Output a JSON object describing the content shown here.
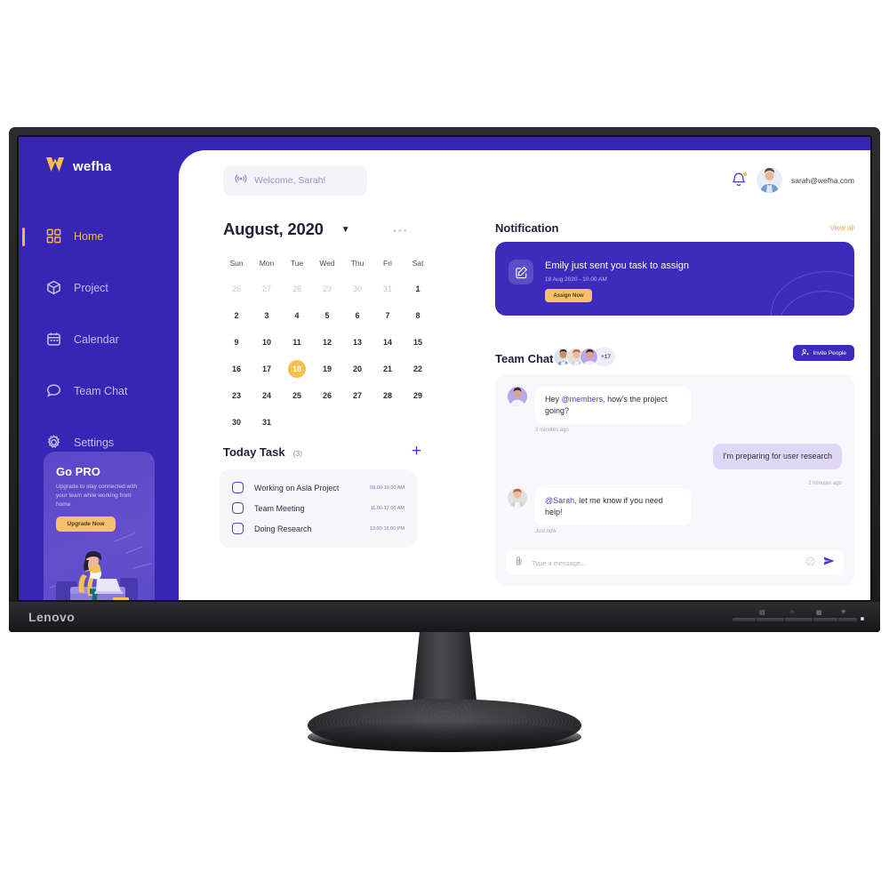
{
  "device": {
    "brand": "Lenovo",
    "control_labels": [
      "⏻",
      "☰",
      "≡",
      "↵"
    ]
  },
  "sidebar": {
    "brand": "wefha",
    "logo_icon": "wefha-w-logo-icon",
    "active_index": 0,
    "items": [
      {
        "label": "Home",
        "icon": "grid-icon"
      },
      {
        "label": "Project",
        "icon": "cube-icon"
      },
      {
        "label": "Calendar",
        "icon": "calendar-icon"
      },
      {
        "label": "Team Chat",
        "icon": "chat-bubble-icon"
      },
      {
        "label": "Settings",
        "icon": "gear-icon"
      }
    ],
    "promo": {
      "title": "Go PRO",
      "description": "Upgrade to stay connected with your team while working from home",
      "button": "Upgrade Now"
    }
  },
  "header": {
    "search_placeholder": "Welcome, Sarah!",
    "search_icon": "broadcast-icon",
    "bell_icon": "bell-icon",
    "avatar_icon": "user-avatar",
    "email": "sarah@wefha.com"
  },
  "calendar": {
    "title": "August, 2020",
    "caret_icon": "chevron-down-icon",
    "more_icon": "more-horizontal-icon",
    "day_names": [
      "Sun",
      "Mon",
      "Tue",
      "Wed",
      "Thu",
      "Fri",
      "Sat"
    ],
    "selected_day": 18,
    "weeks": [
      [
        {
          "d": "26",
          "mute": true
        },
        {
          "d": "27",
          "mute": true
        },
        {
          "d": "28",
          "mute": true
        },
        {
          "d": "29",
          "mute": true
        },
        {
          "d": "30",
          "mute": true
        },
        {
          "d": "31",
          "mute": true
        },
        {
          "d": "1",
          "mute": false
        }
      ],
      [
        {
          "d": "2",
          "mute": false
        },
        {
          "d": "3",
          "mute": false
        },
        {
          "d": "4",
          "mute": false
        },
        {
          "d": "5",
          "mute": false
        },
        {
          "d": "6",
          "mute": false
        },
        {
          "d": "7",
          "mute": false
        },
        {
          "d": "8",
          "mute": false
        }
      ],
      [
        {
          "d": "9",
          "mute": false
        },
        {
          "d": "10",
          "mute": false
        },
        {
          "d": "11",
          "mute": false
        },
        {
          "d": "12",
          "mute": false
        },
        {
          "d": "13",
          "mute": false
        },
        {
          "d": "14",
          "mute": false
        },
        {
          "d": "15",
          "mute": false
        }
      ],
      [
        {
          "d": "16",
          "mute": false
        },
        {
          "d": "17",
          "mute": false
        },
        {
          "d": "18",
          "mute": false,
          "sel": true
        },
        {
          "d": "19",
          "mute": false
        },
        {
          "d": "20",
          "mute": false
        },
        {
          "d": "21",
          "mute": false
        },
        {
          "d": "22",
          "mute": false
        }
      ],
      [
        {
          "d": "23",
          "mute": false
        },
        {
          "d": "24",
          "mute": false
        },
        {
          "d": "25",
          "mute": false
        },
        {
          "d": "26",
          "mute": false
        },
        {
          "d": "27",
          "mute": false
        },
        {
          "d": "28",
          "mute": false
        },
        {
          "d": "29",
          "mute": false
        }
      ],
      [
        {
          "d": "30",
          "mute": false
        },
        {
          "d": "31",
          "mute": false
        },
        {
          "d": "",
          "mute": false
        },
        {
          "d": "",
          "mute": false
        },
        {
          "d": "",
          "mute": false
        },
        {
          "d": "",
          "mute": false
        },
        {
          "d": "",
          "mute": false
        }
      ]
    ]
  },
  "today_task": {
    "title": "Today Task",
    "count": "(3)",
    "add_icon": "plus-icon",
    "items": [
      {
        "name": "Working on Asla Project",
        "time": "08.00-10.00 AM",
        "checked": false
      },
      {
        "name": "Team Meeting",
        "time": "11.00-12.00 AM",
        "checked": false
      },
      {
        "name": "Doing Research",
        "time": "13.00-16.00 PM",
        "checked": false
      }
    ]
  },
  "notification": {
    "title": "Notification",
    "view_all": "View all",
    "card": {
      "icon": "edit-square-icon",
      "message": "Emily just sent you task to assign",
      "timestamp": "18 Aug 2020 - 10.00 AM",
      "button": "Assign Now"
    }
  },
  "team_chat": {
    "title": "Team Chat",
    "extra_members": "+17",
    "invite_button": "Invite People",
    "invite_icon": "add-person-icon",
    "messages": [
      {
        "side": "left",
        "mention": "@members,",
        "pre": "Hey ",
        "post": " how's the project going?",
        "time": "3 minutes ago"
      },
      {
        "side": "right",
        "text": "I'm preparing for user research",
        "time": "2 minutes ago"
      },
      {
        "side": "left",
        "mention": "@Sarah,",
        "pre": "",
        "post": " let me know if you need help!",
        "time": "Just now"
      }
    ],
    "input": {
      "placeholder": "Type a message...",
      "attach_icon": "paperclip-icon",
      "emoji_icon": "smiley-icon",
      "send_icon": "send-icon"
    }
  },
  "colors": {
    "sidebar_purple": "#3726b5",
    "card_purple": "#3d2bbb",
    "accent_yellow": "#f7c04a",
    "promo_purple": "#5a46c8",
    "chat_bg": "#f8f7fc"
  }
}
